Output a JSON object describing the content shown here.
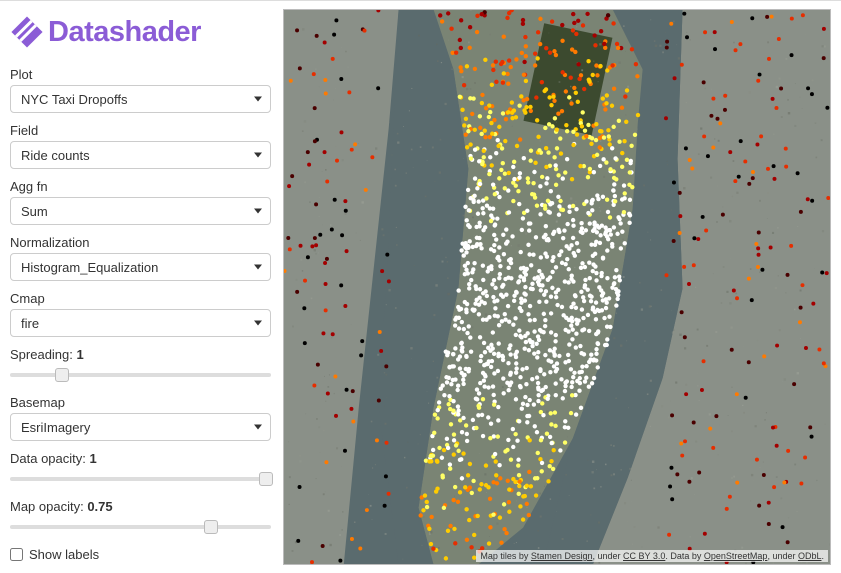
{
  "brand": {
    "name": "Datashader"
  },
  "controls": {
    "plot": {
      "label": "Plot",
      "value": "NYC Taxi Dropoffs"
    },
    "field": {
      "label": "Field",
      "value": "Ride counts"
    },
    "aggfn": {
      "label": "Agg fn",
      "value": "Sum"
    },
    "norm": {
      "label": "Normalization",
      "value": "Histogram_Equalization"
    },
    "cmap": {
      "label": "Cmap",
      "value": "fire"
    },
    "basemap": {
      "label": "Basemap",
      "value": "EsriImagery"
    },
    "spreading": {
      "label": "Spreading: ",
      "value": "1",
      "pos": 0.2
    },
    "data_opacity": {
      "label": "Data opacity: ",
      "value": "1",
      "pos": 0.98
    },
    "map_opacity": {
      "label": "Map opacity: ",
      "value": "0.75",
      "pos": 0.77
    },
    "show_labels": {
      "label": "Show labels",
      "checked": false
    }
  },
  "map": {
    "attribution": {
      "prefix": "Map tiles by ",
      "a1": "Stamen Design",
      "mid1": ", under ",
      "a2": "CC BY 3.0",
      "mid2": ". Data by ",
      "a3": "OpenStreetMap",
      "mid3": ", under ",
      "a4": "ODbL",
      "suffix": "."
    },
    "colors": {
      "water": "#5a6b6e",
      "land": "#7a8474",
      "park": "#4d5c3f",
      "urban_light": "#9aa29a",
      "urban_dark": "#6b716b"
    },
    "cmap_fire": [
      "#000000",
      "#4a0000",
      "#a30000",
      "#e62e00",
      "#ff7a00",
      "#ffcc00",
      "#ffff66",
      "#ffffff"
    ]
  }
}
